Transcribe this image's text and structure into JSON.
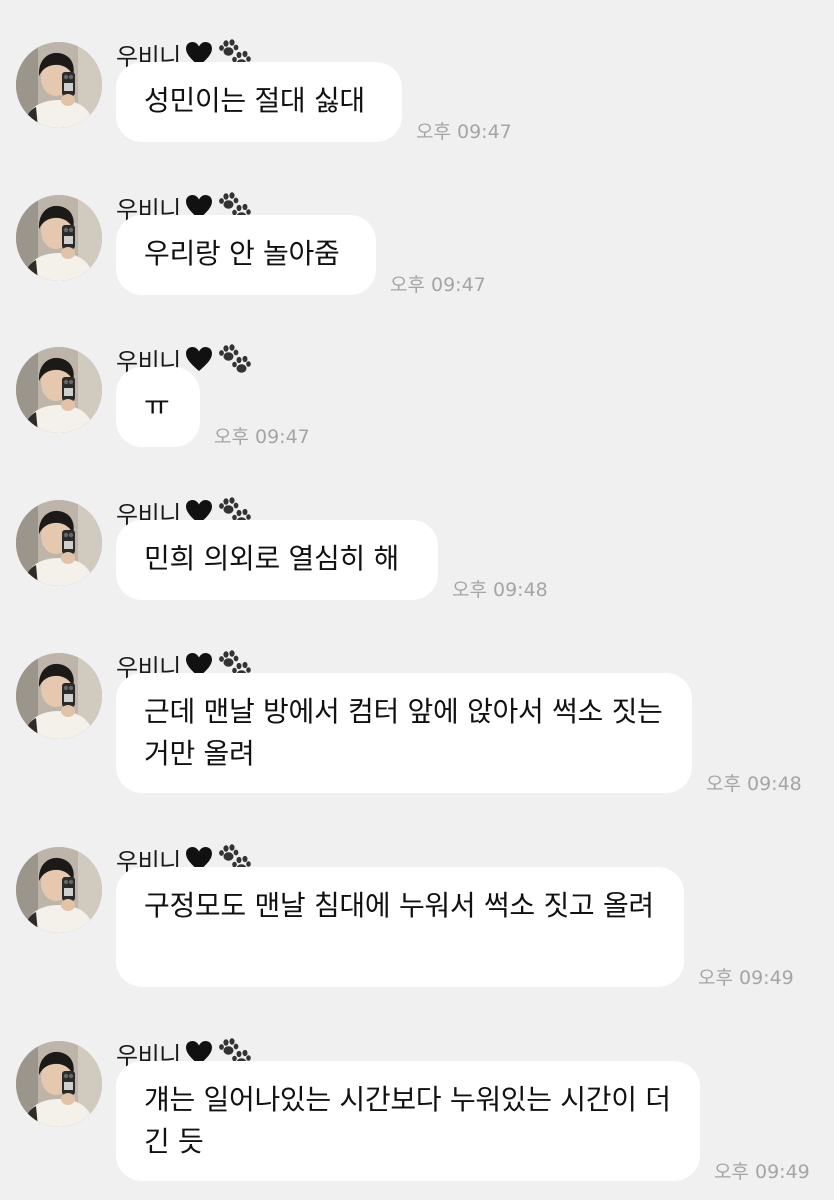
{
  "sender": {
    "name": "우비니",
    "badge_icons": [
      "black-heart-icon",
      "paw-prints-icon"
    ]
  },
  "colors": {
    "background": "#f0f0f0",
    "bubble": "#ffffff",
    "timestamp": "#a5a5a5"
  },
  "messages": [
    {
      "text": "성민이는 절대 싫대",
      "time": "오후 09:47"
    },
    {
      "text": "우리랑 안 놀아줌",
      "time": "오후 09:47"
    },
    {
      "text": "ㅠ",
      "time": "오후 09:47"
    },
    {
      "text": "민희 의외로 열심히 해",
      "time": "오후 09:48"
    },
    {
      "text": "근데 맨날 방에서 컴터 앞에 앉아서 썩소 짓는 거만 올려",
      "time": "오후 09:48"
    },
    {
      "text": "구정모도 맨날 침대에 누워서 썩소 짓고 올려",
      "time": "오후 09:49"
    },
    {
      "text": "걔는 일어나있는 시간보다 누워있는 시간이 더 긴 듯",
      "time": "오후 09:49"
    }
  ]
}
